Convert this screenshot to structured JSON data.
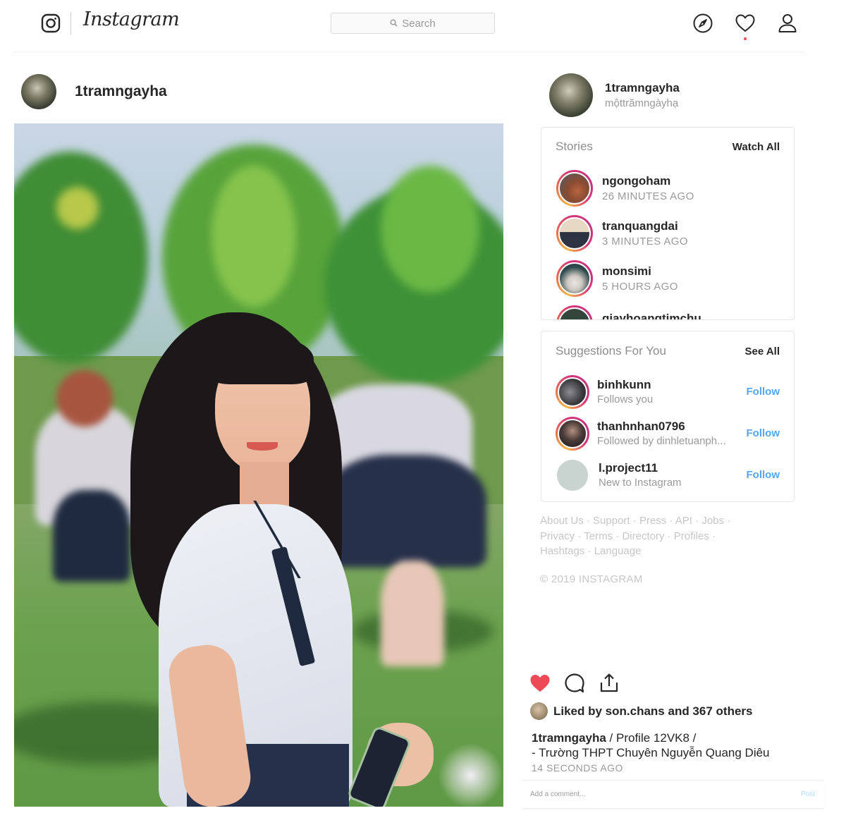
{
  "header": {
    "logo_text": "Instagram",
    "search_placeholder": "Search",
    "icons": [
      "compass-icon",
      "heart-icon",
      "user-icon"
    ],
    "has_notification": true
  },
  "post": {
    "author": "1tramngayha",
    "image_alt": "Smiling girl in white school uniform on a green field",
    "liked": true,
    "liked_by_text": "Liked by son.chans and 367 others",
    "caption_user": "1tramngayha",
    "caption_line1": " / Profile 12VK8 /",
    "caption_line2": "- Trường THPT Chuyên Nguyễn Quang Diêu",
    "time_ago": "14 SECONDS AGO",
    "comment_placeholder": "Add a comment...",
    "post_label": "Post"
  },
  "profile": {
    "username": "1tramngayha",
    "full_name": "mộttrămngàyhạ"
  },
  "stories": {
    "title": "Stories",
    "action": "Watch All",
    "items": [
      {
        "name": "ngongoham",
        "time": "26 MINUTES AGO"
      },
      {
        "name": "tranquangdai",
        "time": "3 MINUTES AGO"
      },
      {
        "name": "monsimi",
        "time": "5 HOURS AGO"
      },
      {
        "name": "giayhoangtimchu",
        "time": ""
      }
    ]
  },
  "suggestions": {
    "title": "Suggestions For You",
    "action": "See All",
    "follow_label": "Follow",
    "items": [
      {
        "name": "binhkunn",
        "sub": "Follows you"
      },
      {
        "name": "thanhnhan0796",
        "sub": "Followed by dinhletuanph..."
      },
      {
        "name": "l.project11",
        "sub": "New to Instagram"
      }
    ]
  },
  "footer": {
    "links": [
      "About Us",
      "Support",
      "Press",
      "API",
      "Jobs",
      "Privacy",
      "Terms",
      "Directory",
      "Profiles",
      "Hashtags",
      "Language"
    ],
    "copyright": "© 2019 INSTAGRAM"
  },
  "colors": {
    "like_red": "#ed4956",
    "follow_blue": "#3897f0",
    "muted_text": "#9a9a9a"
  }
}
